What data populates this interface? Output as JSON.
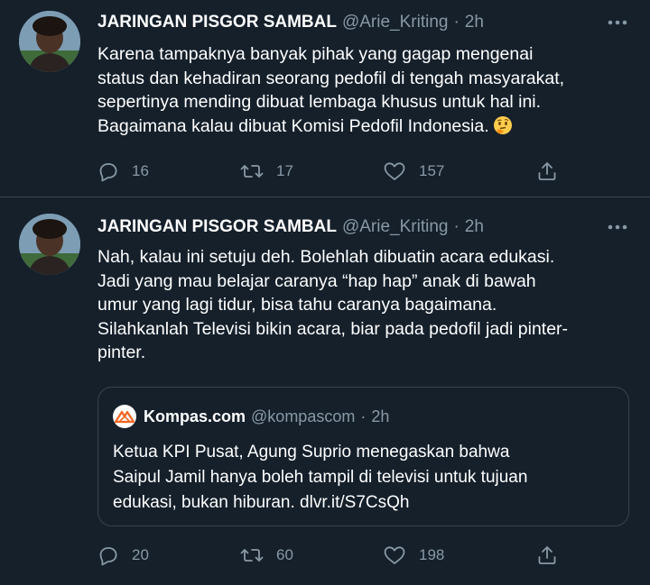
{
  "colors": {
    "background": "#15202b",
    "secondary_text": "#8899a6",
    "border": "#38444d"
  },
  "tweets": [
    {
      "name": "JARINGAN PISGOR SAMBAL",
      "handle": "@Arie_Kriting",
      "separator": "·",
      "time": "2h",
      "lines": [
        "Karena tampaknya banyak pihak yang gagap mengenai",
        "status dan kehadiran seorang pedofil di tengah masyarakat,",
        "sepertinya mending dibuat lembaga khusus untuk hal ini.",
        "Bagaimana kalau dibuat Komisi Pedofil Indonesia."
      ],
      "emoji": "thinking-face",
      "replies": "16",
      "retweets": "17",
      "likes": "157"
    },
    {
      "name": "JARINGAN PISGOR SAMBAL",
      "handle": "@Arie_Kriting",
      "separator": "·",
      "time": "2h",
      "lines": [
        "Nah, kalau ini setuju deh. Bolehlah dibuatin acara edukasi.",
        "Jadi yang mau belajar caranya “hap hap” anak di bawah",
        "umur yang lagi tidur, bisa tahu caranya bagaimana.",
        "Silahkanlah Televisi bikin acara, biar pada pedofil jadi pinter-",
        "pinter."
      ],
      "replies": "20",
      "retweets": "60",
      "likes": "198",
      "quote": {
        "name": "Kompas.com",
        "handle": "@kompascom",
        "separator": "·",
        "time": "2h",
        "lines": [
          "Ketua KPI Pusat, Agung Suprio menegaskan bahwa",
          "Saipul Jamil hanya boleh tampil di televisi untuk tujuan",
          "edukasi, bukan hiburan. dlvr.it/S7CsQh"
        ]
      }
    }
  ]
}
